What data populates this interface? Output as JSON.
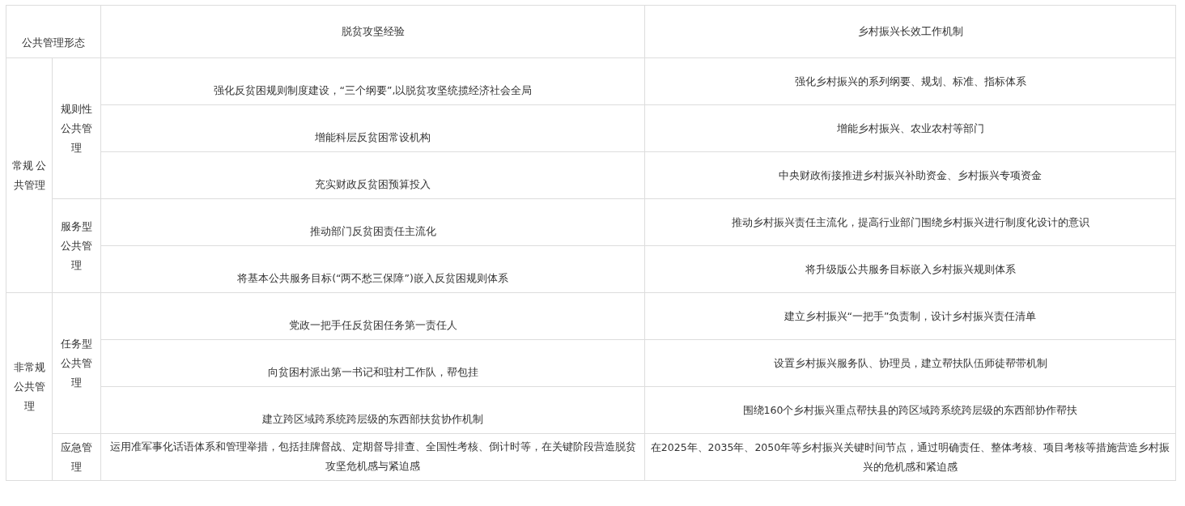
{
  "table": {
    "columns": [
      "公共管理形态",
      "脱贫攻坚经验",
      "乡村振兴长效工作机制"
    ],
    "groups": [
      {
        "label": "常规 公共管理",
        "subgroups": [
          {
            "label": "规则性公共管理",
            "rows": [
              {
                "experience": "强化反贫困规则制度建设，“三个纲要”,以脱贫攻坚统揽经济社会全局",
                "mechanism": "强化乡村振兴的系列纲要、规划、标准、指标体系"
              },
              {
                "experience": "增能科层反贫困常设机构",
                "mechanism": "增能乡村振兴、农业农村等部门"
              },
              {
                "experience": "充实财政反贫困预算投入",
                "mechanism": "中央财政衔接推进乡村振兴补助资金、乡村振兴专项资金"
              }
            ]
          },
          {
            "label": "服务型公共管理",
            "rows": [
              {
                "experience": "推动部门反贫困责任主流化",
                "mechanism": "推动乡村振兴责任主流化，提高行业部门围绕乡村振兴进行制度化设计的意识"
              },
              {
                "experience": "将基本公共服务目标(“两不愁三保障”)嵌入反贫困规则体系",
                "mechanism": "将升级版公共服务目标嵌入乡村振兴规则体系"
              }
            ]
          }
        ]
      },
      {
        "label": "非常规公共管理",
        "subgroups": [
          {
            "label": "任务型公共管理",
            "rows": [
              {
                "experience": "党政一把手任反贫困任务第一责任人",
                "mechanism": "建立乡村振兴“一把手”负责制，设计乡村振兴责任清单"
              },
              {
                "experience": "向贫困村派出第一书记和驻村工作队，帮包挂",
                "mechanism": "设置乡村振兴服务队、协理员，建立帮扶队伍师徒帮带机制"
              },
              {
                "experience": "建立跨区域跨系统跨层级的东西部扶贫协作机制",
                "mechanism": "围绕160个乡村振兴重点帮扶县的跨区域跨系统跨层级的东西部协作帮扶"
              }
            ]
          },
          {
            "label": "应急管理",
            "rows": [
              {
                "experience": "运用准军事化话语体系和管理举措，包括挂牌督战、定期督导排查、全国性考核、倒计时等，在关键阶段营造脱贫攻坚危机感与紧迫感",
                "mechanism": "在2025年、2035年、2050年等乡村振兴关键时间节点，通过明确责任、整体考核、项目考核等措施营造乡村振兴的危机感和紧迫感"
              }
            ]
          }
        ]
      }
    ]
  }
}
